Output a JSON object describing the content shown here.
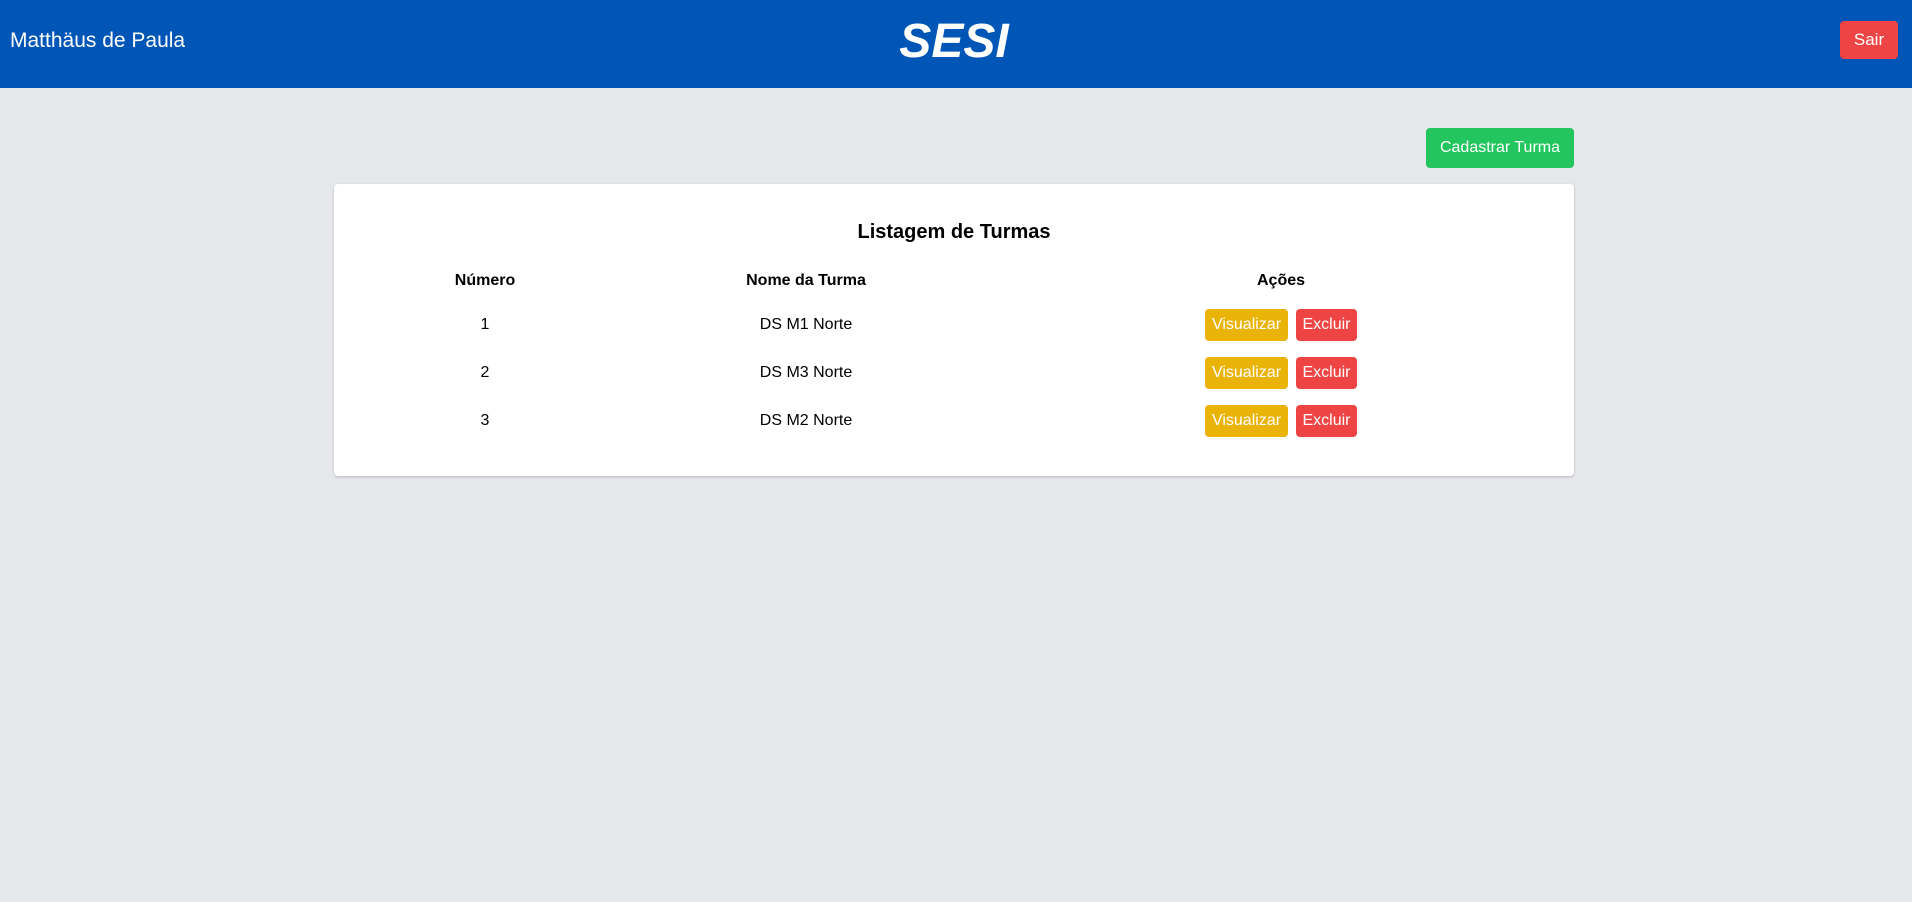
{
  "header": {
    "user_name": "Matthäus de Paula",
    "logo_text": "SESI",
    "logout_label": "Sair"
  },
  "toolbar": {
    "add_class_label": "Cadastrar Turma"
  },
  "table": {
    "title": "Listagem de Turmas",
    "columns": [
      "Número",
      "Nome da Turma",
      "Ações"
    ],
    "rows": [
      {
        "number": "1",
        "name": "DS M1 Norte",
        "view_label": "Visualizar",
        "delete_label": "Excluir"
      },
      {
        "number": "2",
        "name": "DS M3 Norte",
        "view_label": "Visualizar",
        "delete_label": "Excluir"
      },
      {
        "number": "3",
        "name": "DS M2 Norte",
        "view_label": "Visualizar",
        "delete_label": "Excluir"
      }
    ]
  },
  "colors": {
    "header_bg": "#0056b7",
    "page_bg": "#e5e7eb",
    "danger": "#ef4444",
    "success": "#22c55e",
    "warning": "#eab308"
  }
}
